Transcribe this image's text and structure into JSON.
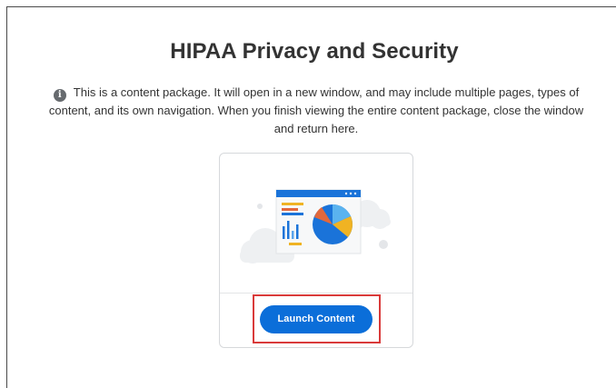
{
  "page": {
    "title": "HIPAA Privacy and Security",
    "info_text": "This is a content package. It will open in a new window, and may include multiple pages, types of content, and its own navigation. When you finish viewing the entire content package, close the window and return here.",
    "info_icon": "info-icon"
  },
  "card": {
    "illustration": "chart-illustration",
    "launch_label": "Launch Content"
  },
  "colors": {
    "accent": "#0B6ED9",
    "highlight": "#D93A3A",
    "title": "#333333"
  }
}
